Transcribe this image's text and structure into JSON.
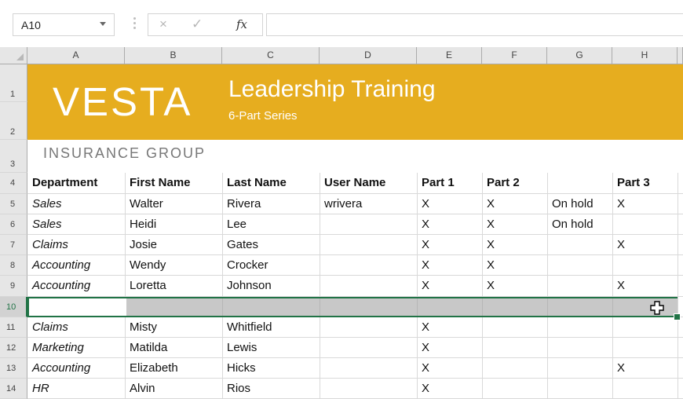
{
  "namebox": {
    "value": "A10"
  },
  "formula_bar": {
    "cancel_icon": "×",
    "enter_icon": "✓",
    "fx_label": "fx",
    "content": ""
  },
  "columns": [
    "A",
    "B",
    "C",
    "D",
    "E",
    "F",
    "G",
    "H"
  ],
  "rows": [
    "1",
    "2",
    "3",
    "4",
    "5",
    "6",
    "7",
    "8",
    "9",
    "10",
    "11",
    "12",
    "13",
    "14"
  ],
  "banner": {
    "logo": "VESTA",
    "title": "Leadership Training",
    "subtitle": "6-Part Series",
    "company": "INSURANCE  GROUP",
    "color": "#e6ad1f"
  },
  "table": {
    "headers": [
      "Department",
      "First Name",
      "Last Name",
      "User Name",
      "Part 1",
      "Part 2",
      "",
      "Part 3"
    ],
    "rows": [
      [
        "Sales",
        "Walter",
        "Rivera",
        "wrivera",
        "X",
        "X",
        "On hold",
        "X"
      ],
      [
        "Sales",
        "Heidi",
        "Lee",
        "",
        "X",
        "X",
        "On hold",
        ""
      ],
      [
        "Claims",
        "Josie",
        "Gates",
        "",
        "X",
        "X",
        "",
        "X"
      ],
      [
        "Accounting",
        "Wendy",
        "Crocker",
        "",
        "X",
        "X",
        "",
        ""
      ],
      [
        "Accounting",
        "Loretta",
        "Johnson",
        "",
        "X",
        "X",
        "",
        "X"
      ],
      [
        "",
        "",
        "",
        "",
        "",
        "",
        "",
        ""
      ],
      [
        "Claims",
        "Misty",
        "Whitfield",
        "",
        "X",
        "",
        "",
        ""
      ],
      [
        "Marketing",
        "Matilda",
        "Lewis",
        "",
        "X",
        "",
        "",
        ""
      ],
      [
        "Accounting",
        "Elizabeth",
        "Hicks",
        "",
        "X",
        "",
        "",
        "X"
      ],
      [
        "HR",
        "Alvin",
        "Rios",
        "",
        "X",
        "",
        "",
        ""
      ]
    ]
  },
  "selection": {
    "row": "10",
    "accent": "#217346"
  }
}
